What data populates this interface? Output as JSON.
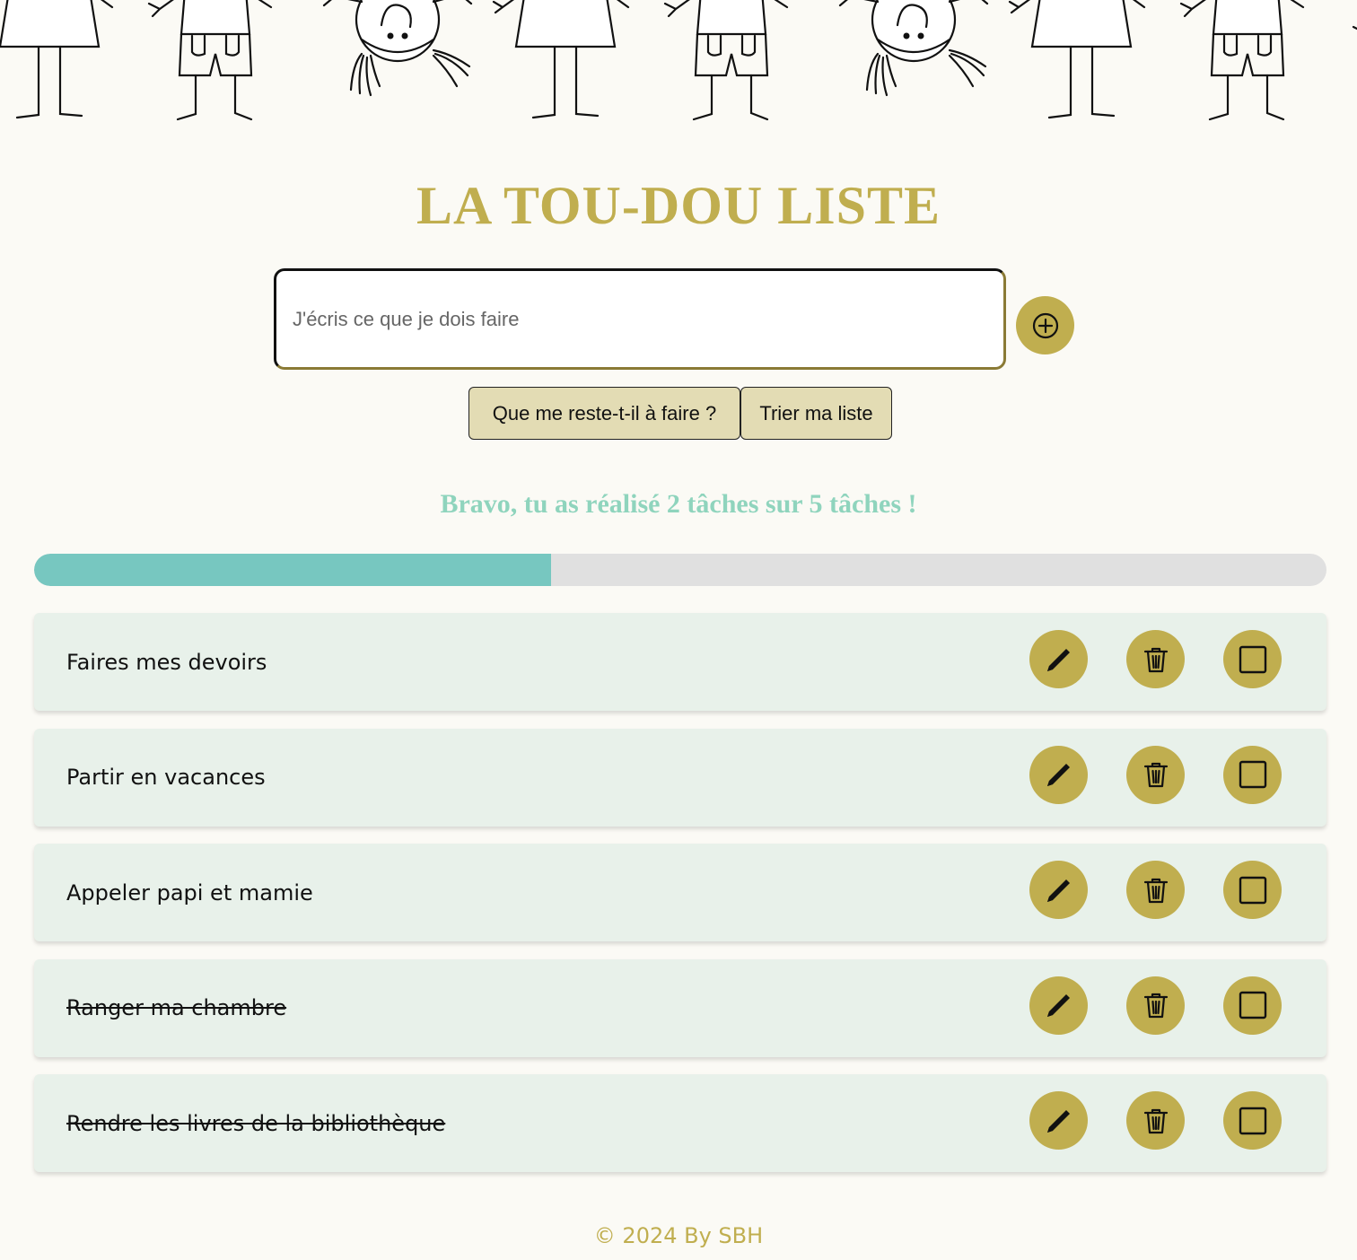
{
  "app": {
    "title": "LA TOU-DOU LISTE",
    "footer": "© 2024 By SBH"
  },
  "form": {
    "placeholder": "J'écris ce que je dois faire",
    "add_icon": "plus-circle-icon"
  },
  "actions": {
    "remaining_label": "Que me reste-t-il à faire ?",
    "sort_label": "Trier ma liste"
  },
  "progress": {
    "message": "Bravo, tu as réalisé 2 tâches sur 5 tâches !",
    "completed": 2,
    "total": 5
  },
  "tasks": [
    {
      "label": "Faires mes devoirs",
      "done": false
    },
    {
      "label": "Partir en vacances",
      "done": false
    },
    {
      "label": "Appeler papi et mamie",
      "done": false
    },
    {
      "label": "Ranger ma chambre",
      "done": true
    },
    {
      "label": "Rendre les livres de la bibliothèque",
      "done": true
    }
  ],
  "task_icons": {
    "edit": "pencil-icon",
    "delete": "trash-icon",
    "check": "checkbox-icon"
  },
  "colors": {
    "accent": "#c0ae4f",
    "progress_fill": "#77c7c0",
    "progress_text": "#8fd4bd",
    "task_background": "#e8f1ea",
    "page_background": "#fbfaf5"
  }
}
